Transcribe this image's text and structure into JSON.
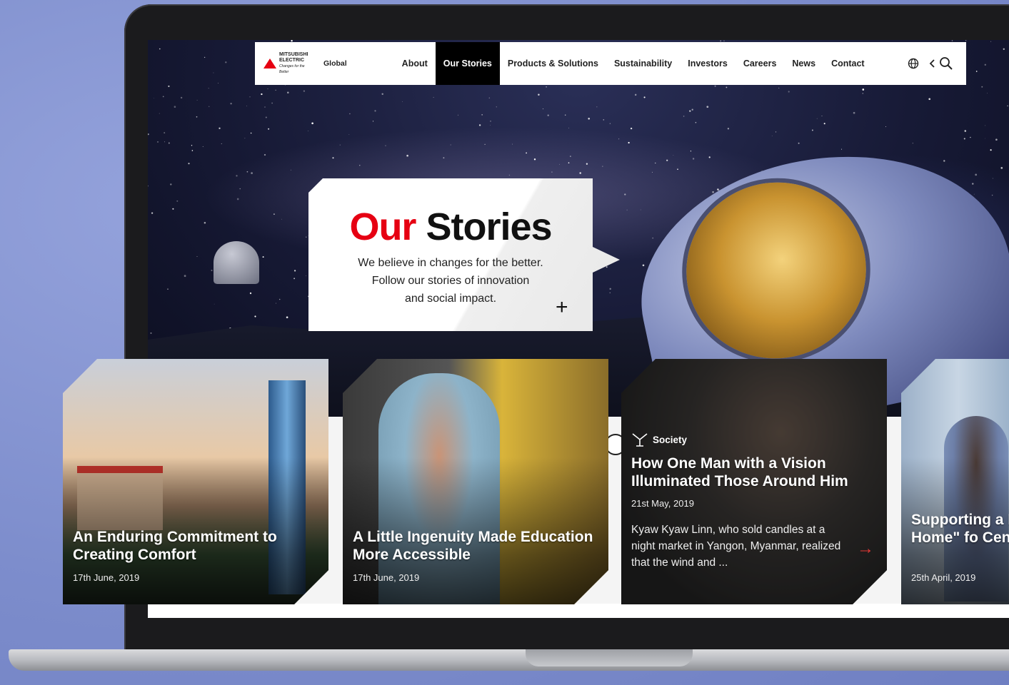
{
  "nav": {
    "logo_text": [
      "MITSUBISHI",
      "ELECTRIC",
      "Changes for the Better"
    ],
    "region": "Global",
    "items": [
      {
        "label": "About",
        "active": false
      },
      {
        "label": "Our Stories",
        "active": true
      },
      {
        "label": "Products & Solutions",
        "active": false
      },
      {
        "label": "Sustainability",
        "active": false
      },
      {
        "label": "Investors",
        "active": false
      },
      {
        "label": "Careers",
        "active": false
      },
      {
        "label": "News",
        "active": false
      },
      {
        "label": "Contact",
        "active": false
      }
    ],
    "icons": [
      "globe-icon",
      "chevron-left-icon",
      "search-icon"
    ]
  },
  "hero": {
    "title_red": "Our",
    "title_black": "Stories",
    "subtitle_lines": [
      "We believe in changes for the better.",
      "Follow our stories of innovation",
      "and social impact."
    ],
    "expand_symbol": "+"
  },
  "cards": [
    {
      "title": "An Enduring Commitment to Creating Comfort",
      "date": "17th June, 2019"
    },
    {
      "title": "A Little Ingenuity Made Education More Accessible",
      "date": "17th June, 2019"
    },
    {
      "category": "Society",
      "title": "How One Man with a Vision Illuminated Those Around Him",
      "date": "21st May, 2019",
      "excerpt": "Kyaw Kyaw Linn, who sold candles at a night market in Yangon, Myanmar, realized that the wind and ...",
      "arrow": "→"
    },
    {
      "title": "Supporting a N \"Our Home\" fo Century",
      "date": "25th April, 2019"
    }
  ],
  "colors": {
    "brand_red": "#e60012",
    "background": "#7f8fce",
    "nav_active": "#000000"
  }
}
